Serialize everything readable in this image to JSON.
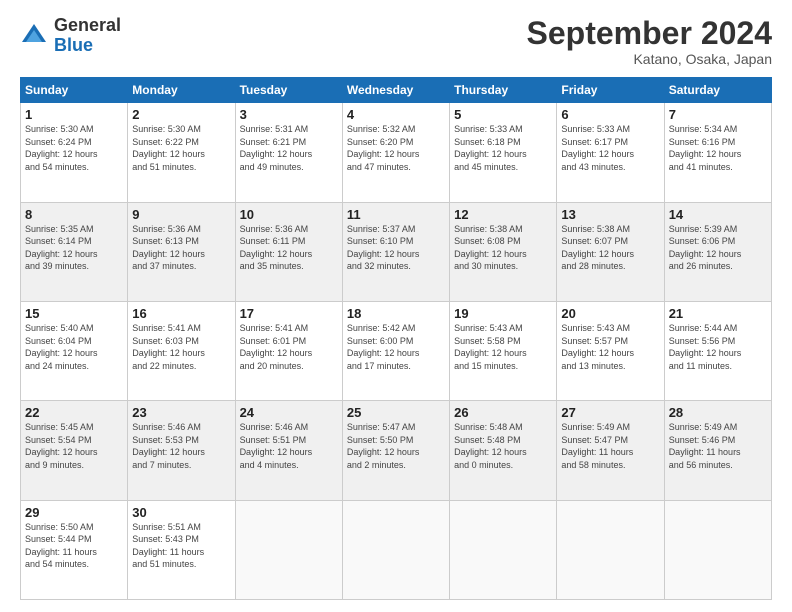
{
  "header": {
    "logo_general": "General",
    "logo_blue": "Blue",
    "month_title": "September 2024",
    "subtitle": "Katano, Osaka, Japan"
  },
  "calendar": {
    "headers": [
      "Sunday",
      "Monday",
      "Tuesday",
      "Wednesday",
      "Thursday",
      "Friday",
      "Saturday"
    ],
    "rows": [
      [
        {
          "day": "1",
          "detail": "Sunrise: 5:30 AM\nSunset: 6:24 PM\nDaylight: 12 hours\nand 54 minutes."
        },
        {
          "day": "2",
          "detail": "Sunrise: 5:30 AM\nSunset: 6:22 PM\nDaylight: 12 hours\nand 51 minutes."
        },
        {
          "day": "3",
          "detail": "Sunrise: 5:31 AM\nSunset: 6:21 PM\nDaylight: 12 hours\nand 49 minutes."
        },
        {
          "day": "4",
          "detail": "Sunrise: 5:32 AM\nSunset: 6:20 PM\nDaylight: 12 hours\nand 47 minutes."
        },
        {
          "day": "5",
          "detail": "Sunrise: 5:33 AM\nSunset: 6:18 PM\nDaylight: 12 hours\nand 45 minutes."
        },
        {
          "day": "6",
          "detail": "Sunrise: 5:33 AM\nSunset: 6:17 PM\nDaylight: 12 hours\nand 43 minutes."
        },
        {
          "day": "7",
          "detail": "Sunrise: 5:34 AM\nSunset: 6:16 PM\nDaylight: 12 hours\nand 41 minutes."
        }
      ],
      [
        {
          "day": "8",
          "detail": "Sunrise: 5:35 AM\nSunset: 6:14 PM\nDaylight: 12 hours\nand 39 minutes."
        },
        {
          "day": "9",
          "detail": "Sunrise: 5:36 AM\nSunset: 6:13 PM\nDaylight: 12 hours\nand 37 minutes."
        },
        {
          "day": "10",
          "detail": "Sunrise: 5:36 AM\nSunset: 6:11 PM\nDaylight: 12 hours\nand 35 minutes."
        },
        {
          "day": "11",
          "detail": "Sunrise: 5:37 AM\nSunset: 6:10 PM\nDaylight: 12 hours\nand 32 minutes."
        },
        {
          "day": "12",
          "detail": "Sunrise: 5:38 AM\nSunset: 6:08 PM\nDaylight: 12 hours\nand 30 minutes."
        },
        {
          "day": "13",
          "detail": "Sunrise: 5:38 AM\nSunset: 6:07 PM\nDaylight: 12 hours\nand 28 minutes."
        },
        {
          "day": "14",
          "detail": "Sunrise: 5:39 AM\nSunset: 6:06 PM\nDaylight: 12 hours\nand 26 minutes."
        }
      ],
      [
        {
          "day": "15",
          "detail": "Sunrise: 5:40 AM\nSunset: 6:04 PM\nDaylight: 12 hours\nand 24 minutes."
        },
        {
          "day": "16",
          "detail": "Sunrise: 5:41 AM\nSunset: 6:03 PM\nDaylight: 12 hours\nand 22 minutes."
        },
        {
          "day": "17",
          "detail": "Sunrise: 5:41 AM\nSunset: 6:01 PM\nDaylight: 12 hours\nand 20 minutes."
        },
        {
          "day": "18",
          "detail": "Sunrise: 5:42 AM\nSunset: 6:00 PM\nDaylight: 12 hours\nand 17 minutes."
        },
        {
          "day": "19",
          "detail": "Sunrise: 5:43 AM\nSunset: 5:58 PM\nDaylight: 12 hours\nand 15 minutes."
        },
        {
          "day": "20",
          "detail": "Sunrise: 5:43 AM\nSunset: 5:57 PM\nDaylight: 12 hours\nand 13 minutes."
        },
        {
          "day": "21",
          "detail": "Sunrise: 5:44 AM\nSunset: 5:56 PM\nDaylight: 12 hours\nand 11 minutes."
        }
      ],
      [
        {
          "day": "22",
          "detail": "Sunrise: 5:45 AM\nSunset: 5:54 PM\nDaylight: 12 hours\nand 9 minutes."
        },
        {
          "day": "23",
          "detail": "Sunrise: 5:46 AM\nSunset: 5:53 PM\nDaylight: 12 hours\nand 7 minutes."
        },
        {
          "day": "24",
          "detail": "Sunrise: 5:46 AM\nSunset: 5:51 PM\nDaylight: 12 hours\nand 4 minutes."
        },
        {
          "day": "25",
          "detail": "Sunrise: 5:47 AM\nSunset: 5:50 PM\nDaylight: 12 hours\nand 2 minutes."
        },
        {
          "day": "26",
          "detail": "Sunrise: 5:48 AM\nSunset: 5:48 PM\nDaylight: 12 hours\nand 0 minutes."
        },
        {
          "day": "27",
          "detail": "Sunrise: 5:49 AM\nSunset: 5:47 PM\nDaylight: 11 hours\nand 58 minutes."
        },
        {
          "day": "28",
          "detail": "Sunrise: 5:49 AM\nSunset: 5:46 PM\nDaylight: 11 hours\nand 56 minutes."
        }
      ],
      [
        {
          "day": "29",
          "detail": "Sunrise: 5:50 AM\nSunset: 5:44 PM\nDaylight: 11 hours\nand 54 minutes."
        },
        {
          "day": "30",
          "detail": "Sunrise: 5:51 AM\nSunset: 5:43 PM\nDaylight: 11 hours\nand 51 minutes."
        },
        {
          "day": "",
          "detail": ""
        },
        {
          "day": "",
          "detail": ""
        },
        {
          "day": "",
          "detail": ""
        },
        {
          "day": "",
          "detail": ""
        },
        {
          "day": "",
          "detail": ""
        }
      ]
    ]
  }
}
